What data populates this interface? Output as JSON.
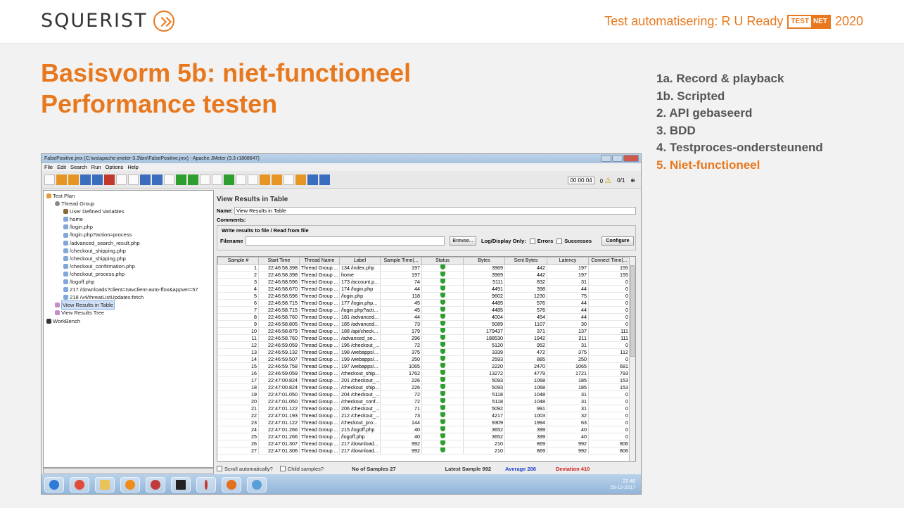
{
  "header": {
    "logo": "SQUERIST",
    "event_prefix": "Test automatisering: R U Ready",
    "badge_a": "TEST",
    "badge_b": "NET",
    "event_year": "2020"
  },
  "title": {
    "line1": "Basisvorm 5b: niet-functioneel",
    "line2": "Performance testen"
  },
  "menu": [
    "1a. Record & playback",
    "1b. Scripted",
    "2. API gebaseerd",
    "3. BDD",
    "4. Testproces-ondersteunend",
    "5. Niet-functioneel"
  ],
  "jmeter": {
    "window_title": "FalsePositive.jmx (C:\\ws\\apache-jmeter-3.3\\bin\\FalsePositive.jmx) - Apache JMeter (3.3 r1808647)",
    "menus": [
      "File",
      "Edit",
      "Search",
      "Run",
      "Options",
      "Help"
    ],
    "timer": "00:00:04",
    "warnings": "0",
    "threads": "0/1",
    "tree": [
      {
        "label": "Test Plan",
        "indent": 0,
        "icon": "plan"
      },
      {
        "label": "Thread Group",
        "indent": 1,
        "icon": "gear"
      },
      {
        "label": "User Defined Variables",
        "indent": 2,
        "icon": "vars"
      },
      {
        "label": "home",
        "indent": 2,
        "icon": "sampler"
      },
      {
        "label": "/login.php",
        "indent": 2,
        "icon": "sampler"
      },
      {
        "label": "/login.php?action=process",
        "indent": 2,
        "icon": "sampler"
      },
      {
        "label": "/advanced_search_result.php",
        "indent": 2,
        "icon": "sampler"
      },
      {
        "label": "/checkout_shipping.php",
        "indent": 2,
        "icon": "sampler"
      },
      {
        "label": "/checkout_shipping.php",
        "indent": 2,
        "icon": "sampler"
      },
      {
        "label": "/checkout_confirmation.php",
        "indent": 2,
        "icon": "sampler"
      },
      {
        "label": "/checkout_process.php",
        "indent": 2,
        "icon": "sampler"
      },
      {
        "label": "/logoff.php",
        "indent": 2,
        "icon": "sampler"
      },
      {
        "label": "217 /downloads?client=navclient-auto-ffox&appver=57",
        "indent": 2,
        "icon": "sampler"
      },
      {
        "label": "218 /v4/threatListUpdates:fetch",
        "indent": 2,
        "icon": "sampler"
      },
      {
        "label": "View Results in Table",
        "indent": 1,
        "icon": "res",
        "selected": true
      },
      {
        "label": "View Results Tree",
        "indent": 1,
        "icon": "res"
      },
      {
        "label": "WorkBench",
        "indent": 0,
        "icon": "wb"
      }
    ],
    "panel_title": "View Results in Table",
    "name_label": "Name:",
    "name_value": "View Results in Table",
    "comments_label": "Comments:",
    "write_legend": "Write results to file / Read from file",
    "filename_label": "Filename",
    "browse": "Browse...",
    "log_display": "Log/Display Only:",
    "errors": "Errors",
    "successes": "Successes",
    "configure": "Configure",
    "columns": [
      "Sample #",
      "Start Time",
      "Thread Name",
      "Label",
      "Sample Time(...",
      "Status",
      "Bytes",
      "Sent Bytes",
      "Latency",
      "Connect Time(..."
    ],
    "rows": [
      [
        "1",
        "22:46:58.398",
        "Thread Group ...",
        "134 /index.php",
        "197",
        "ok",
        "3969",
        "442",
        "197",
        "155"
      ],
      [
        "2",
        "22:46:58.398",
        "Thread Group ...",
        "home",
        "197",
        "ok",
        "3969",
        "442",
        "197",
        "155"
      ],
      [
        "3",
        "22:46:58.596",
        "Thread Group ...",
        "173 /account.p...",
        "74",
        "ok",
        "5111",
        "832",
        "31",
        "0"
      ],
      [
        "4",
        "22:46:58.670",
        "Thread Group ...",
        "174 /login.php",
        "44",
        "ok",
        "4491",
        "398",
        "44",
        "0"
      ],
      [
        "5",
        "22:46:58.596",
        "Thread Group ...",
        "/login.php",
        "118",
        "ok",
        "9602",
        "1230",
        "75",
        "0"
      ],
      [
        "6",
        "22:46:58.715",
        "Thread Group ...",
        "177 /login.php...",
        "45",
        "ok",
        "4485",
        "576",
        "44",
        "0"
      ],
      [
        "7",
        "22:46:58.715",
        "Thread Group ...",
        "/login.php?acti...",
        "45",
        "ok",
        "4485",
        "576",
        "44",
        "0"
      ],
      [
        "8",
        "22:46:58.760",
        "Thread Group ...",
        "181 /advanced...",
        "44",
        "ok",
        "4004",
        "454",
        "44",
        "0"
      ],
      [
        "9",
        "22:46:58.805",
        "Thread Group ...",
        "185 /advanced...",
        "73",
        "ok",
        "5089",
        "1107",
        "30",
        "0"
      ],
      [
        "10",
        "22:46:58.879",
        "Thread Group ...",
        "188 /api/check...",
        "179",
        "ok",
        "179437",
        "371",
        "137",
        "111"
      ],
      [
        "11",
        "22:46:58.760",
        "Thread Group ...",
        "/advanced_se...",
        "296",
        "ok",
        "188530",
        "1942",
        "211",
        "111"
      ],
      [
        "12",
        "22:46:59.059",
        "Thread Group ...",
        "196 /checkout_...",
        "72",
        "ok",
        "5120",
        "952",
        "31",
        "0"
      ],
      [
        "13",
        "22:46:59.132",
        "Thread Group ...",
        "198 /webapps/...",
        "375",
        "ok",
        "3339",
        "472",
        "375",
        "112"
      ],
      [
        "14",
        "22:46:59.507",
        "Thread Group ...",
        "199 /webapps/...",
        "250",
        "ok",
        "2593",
        "885",
        "250",
        "0"
      ],
      [
        "15",
        "22:46:59.758",
        "Thread Group ...",
        "197 /webapps/...",
        "1065",
        "ok",
        "2220",
        "2470",
        "1065",
        "681"
      ],
      [
        "16",
        "22:46:59.059",
        "Thread Group ...",
        "/checkout_ship...",
        "1762",
        "ok",
        "13272",
        "4779",
        "1721",
        "793"
      ],
      [
        "17",
        "22:47:00.824",
        "Thread Group ...",
        "201 /checkout_...",
        "226",
        "ok",
        "5093",
        "1068",
        "185",
        "153"
      ],
      [
        "18",
        "22:47:00.824",
        "Thread Group ...",
        "/checkout_ship...",
        "226",
        "ok",
        "5093",
        "1068",
        "185",
        "153"
      ],
      [
        "19",
        "22:47:01.050",
        "Thread Group ...",
        "204 /checkout_...",
        "72",
        "ok",
        "5118",
        "1048",
        "31",
        "0"
      ],
      [
        "20",
        "22:47:01.050",
        "Thread Group ...",
        "/checkout_conf...",
        "72",
        "ok",
        "5118",
        "1048",
        "31",
        "0"
      ],
      [
        "21",
        "22:47:01.122",
        "Thread Group ...",
        "206 /checkout_...",
        "71",
        "ok",
        "5092",
        "991",
        "31",
        "0"
      ],
      [
        "22",
        "22:47:01.193",
        "Thread Group ...",
        "212 /checkout_...",
        "73",
        "ok",
        "4217",
        "1003",
        "32",
        "0"
      ],
      [
        "23",
        "22:47:01.122",
        "Thread Group ...",
        "/checkout_pro...",
        "144",
        "ok",
        "9309",
        "1994",
        "63",
        "0"
      ],
      [
        "24",
        "22:47:01.266",
        "Thread Group ...",
        "215 /logoff.php",
        "40",
        "ok",
        "3652",
        "399",
        "40",
        "0"
      ],
      [
        "25",
        "22:47:01.266",
        "Thread Group ...",
        "/logoff.php",
        "40",
        "ok",
        "3652",
        "399",
        "40",
        "0"
      ],
      [
        "26",
        "22:47:01.307",
        "Thread Group ...",
        "217 /download...",
        "992",
        "ok",
        "210",
        "869",
        "992",
        "806"
      ],
      [
        "27",
        "22:47:01.306",
        "Thread Group ...",
        "217 /download...",
        "992",
        "ok",
        "210",
        "869",
        "992",
        "806"
      ]
    ],
    "scroll_auto": "Scroll automatically?",
    "child_samples": "Child samples?",
    "no_samples": "No of Samples 27",
    "latest_sample": "Latest Sample 992",
    "average": "Average 288",
    "deviation": "Deviation 410",
    "clock_time": "22:48",
    "clock_date": "25-12-2017"
  },
  "colors": {
    "accent": "#e8781e",
    "average": "#2244cc",
    "deviation": "#cc2222"
  }
}
